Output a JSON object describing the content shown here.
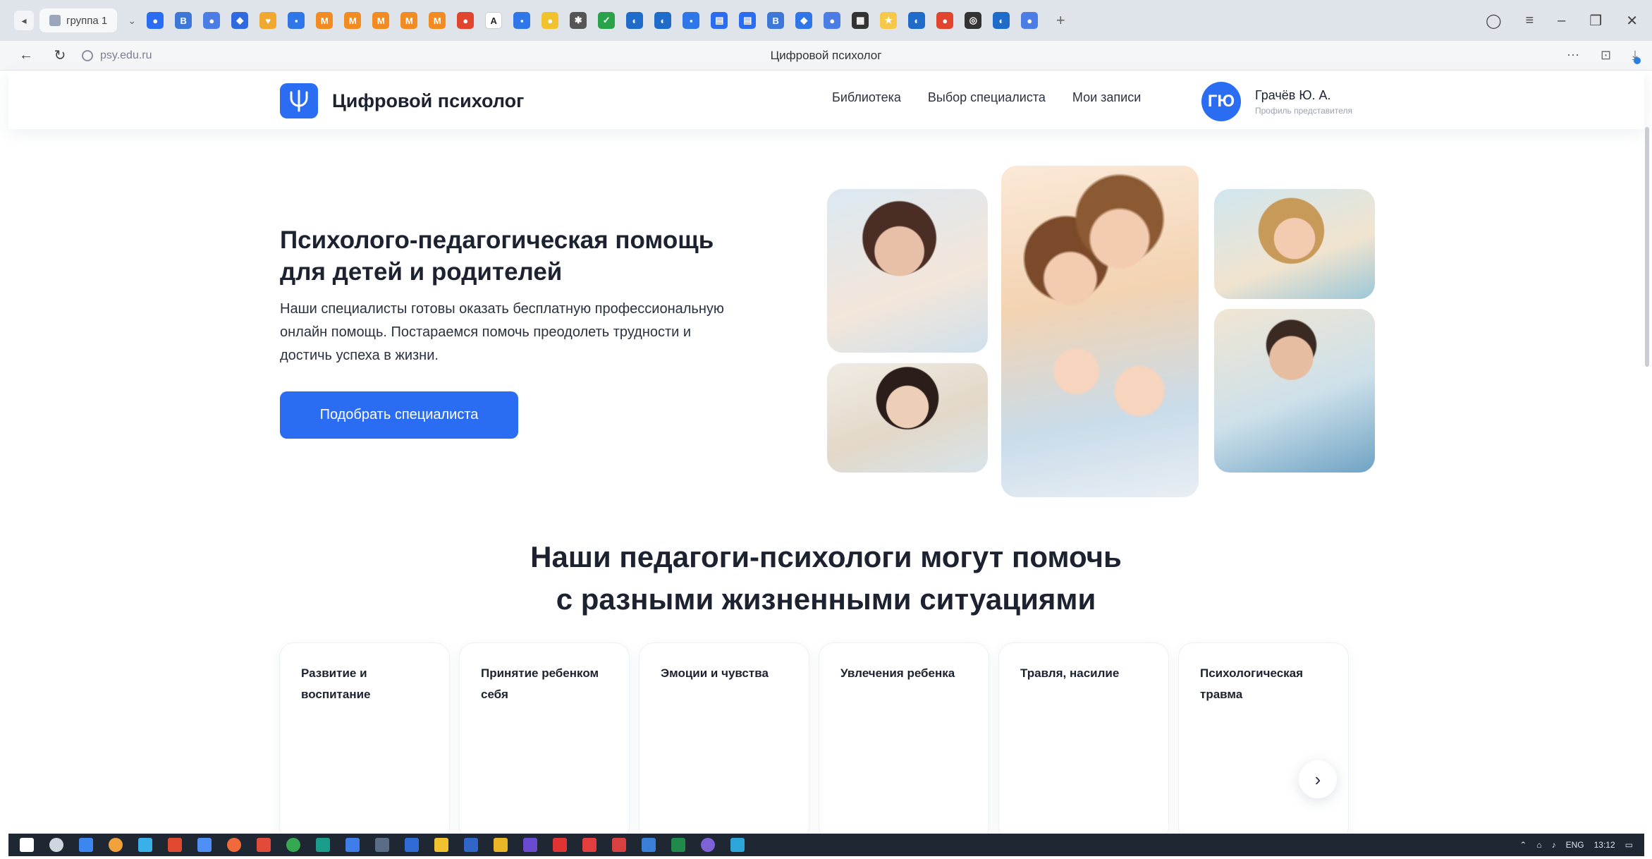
{
  "browser": {
    "tab_group_label": "группа 1",
    "url": "psy.edu.ru",
    "page_title": "Цифровой психолог",
    "pinned_tabs": [
      {
        "icon": "rocket-icon",
        "color": "#2a6cf2",
        "glyph": "●"
      },
      {
        "icon": "vk-icon",
        "color": "#3d78d8",
        "glyph": "В"
      },
      {
        "icon": "app-icon",
        "color": "#4a7ee6",
        "glyph": "●"
      },
      {
        "icon": "shield-icon",
        "color": "#2f6ae0",
        "glyph": "◆"
      },
      {
        "icon": "heart-icon",
        "color": "#f0a830",
        "glyph": "♥"
      },
      {
        "icon": "doc-icon",
        "color": "#2f76e8",
        "glyph": "▪"
      },
      {
        "icon": "mr-icon",
        "color": "#f28b22",
        "glyph": "М"
      },
      {
        "icon": "mr-icon",
        "color": "#f28b22",
        "glyph": "М"
      },
      {
        "icon": "mr-icon",
        "color": "#f28b22",
        "glyph": "М"
      },
      {
        "icon": "mr-icon",
        "color": "#f28b22",
        "glyph": "М"
      },
      {
        "icon": "mr-icon",
        "color": "#f28b22",
        "glyph": "М"
      },
      {
        "icon": "red-app-icon",
        "color": "#e2452e",
        "glyph": "●"
      },
      {
        "icon": "font-icon",
        "color": "#ffffff",
        "glyph": "A"
      },
      {
        "icon": "doc-icon",
        "color": "#2f76e8",
        "glyph": "▪"
      },
      {
        "icon": "yellow-app-icon",
        "color": "#f2c12e",
        "glyph": "●"
      },
      {
        "icon": "gear-icon",
        "color": "#555555",
        "glyph": "✱"
      },
      {
        "icon": "check-icon",
        "color": "#2aa24a",
        "glyph": "✓"
      },
      {
        "icon": "edge-icon",
        "color": "#1e6bc9",
        "glyph": "◐"
      },
      {
        "icon": "edge-icon",
        "color": "#1e6bc9",
        "glyph": "◐"
      },
      {
        "icon": "doc-icon",
        "color": "#2f76e8",
        "glyph": "▪"
      },
      {
        "icon": "book-icon",
        "color": "#2a6cf2",
        "glyph": "▤"
      },
      {
        "icon": "book-icon",
        "color": "#2a6cf2",
        "glyph": "▤"
      },
      {
        "icon": "vk-icon",
        "color": "#3d78d8",
        "glyph": "В"
      },
      {
        "icon": "diamond-icon",
        "color": "#2f76e8",
        "glyph": "◆"
      },
      {
        "icon": "app-icon",
        "color": "#4a7ee6",
        "glyph": "●"
      },
      {
        "icon": "grid-icon",
        "color": "#333333",
        "glyph": "▦"
      },
      {
        "icon": "star-icon",
        "color": "#f5c84a",
        "glyph": "★"
      },
      {
        "icon": "edge-icon",
        "color": "#1e6bc9",
        "glyph": "◐"
      },
      {
        "icon": "red-circle-icon",
        "color": "#e2452e",
        "glyph": "●"
      },
      {
        "icon": "target-icon",
        "color": "#333333",
        "glyph": "◎"
      },
      {
        "icon": "edge-icon",
        "color": "#1e6bc9",
        "glyph": "◐"
      },
      {
        "icon": "app-icon",
        "color": "#4a7ee6",
        "glyph": "●"
      }
    ]
  },
  "site": {
    "logo_text": "Цифровой психолог",
    "nav": [
      "Библиотека",
      "Выбор специалиста",
      "Мои записи"
    ],
    "user": {
      "initials": "ГЮ",
      "name": "Грачёв Ю. А.",
      "role": "Профиль представителя"
    }
  },
  "hero": {
    "title": "Психолого-педагогическая помощь для детей и родителей",
    "text": "Наши специалисты готовы оказать бесплатную профессиональную онлайн помощь. Постараемся помочь преодолеть трудности и достичь успеха в жизни.",
    "button": "Подобрать специалиста"
  },
  "situations": {
    "title_line1": "Наши педагоги-психологи могут помочь",
    "title_line2": "с разными жизненными ситуациями",
    "cards": [
      "Развитие и воспитание",
      "Принятие ребенком себя",
      "Эмоции и чувства",
      "Увлечения ребенка",
      "Травля, насилие",
      "Психологическая травма"
    ]
  },
  "taskbar": {
    "tray_lang": "ENG",
    "tray_time": "13:12"
  },
  "colors": {
    "brand": "#2a6cf2",
    "text": "#1c2230"
  }
}
